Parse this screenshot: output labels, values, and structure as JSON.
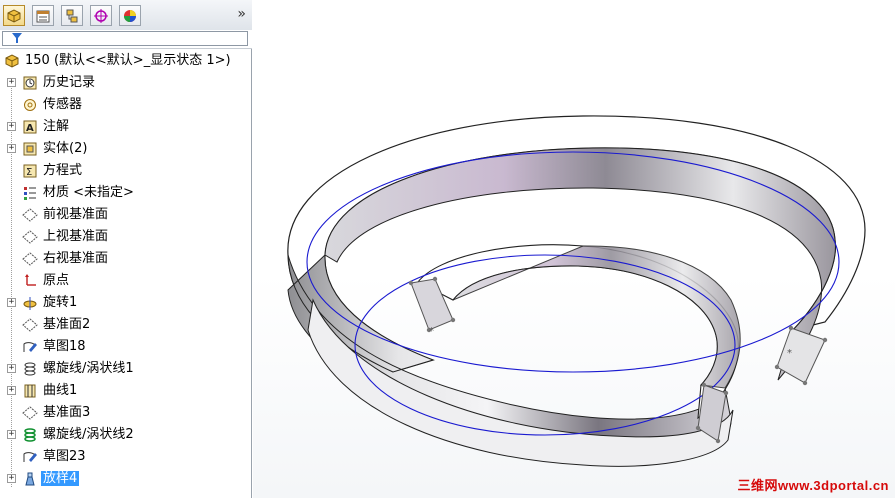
{
  "toolbar": {
    "tabs": [
      {
        "name": "feature-manager-tab",
        "icon": "feature-tree-icon",
        "active": true
      },
      {
        "name": "property-manager-tab",
        "icon": "property-icon",
        "active": false
      },
      {
        "name": "configuration-manager-tab",
        "icon": "configuration-icon",
        "active": false
      },
      {
        "name": "dimxpert-tab",
        "icon": "crosshair-icon",
        "active": false
      },
      {
        "name": "display-manager-tab",
        "icon": "appearance-icon",
        "active": false
      }
    ],
    "more": "»"
  },
  "filter": {
    "icon": "filter-icon",
    "value": ""
  },
  "tree": {
    "root": {
      "label": "150  (默认<<默认>_显示状态 1>)",
      "icon": "part-icon"
    },
    "items": [
      {
        "label": "历史记录",
        "icon": "history-icon",
        "expand": "+"
      },
      {
        "label": "传感器",
        "icon": "sensor-icon",
        "expand": ""
      },
      {
        "label": "注解",
        "icon": "annotation-icon",
        "expand": "+"
      },
      {
        "label": "实体(2)",
        "icon": "solid-bodies-icon",
        "expand": "+"
      },
      {
        "label": "方程式",
        "icon": "equations-icon",
        "expand": ""
      },
      {
        "label": "材质 <未指定>",
        "icon": "material-icon",
        "expand": ""
      },
      {
        "label": "前视基准面",
        "icon": "plane-icon",
        "expand": ""
      },
      {
        "label": "上视基准面",
        "icon": "plane-icon",
        "expand": ""
      },
      {
        "label": "右视基准面",
        "icon": "plane-icon",
        "expand": ""
      },
      {
        "label": "原点",
        "icon": "origin-icon",
        "expand": ""
      },
      {
        "label": "旋转1",
        "icon": "revolve-icon",
        "expand": "+"
      },
      {
        "label": "基准面2",
        "icon": "plane-icon",
        "expand": ""
      },
      {
        "label": "草图18",
        "icon": "sketch-icon",
        "expand": ""
      },
      {
        "label": "螺旋线/涡状线1",
        "icon": "helix-icon",
        "expand": "+"
      },
      {
        "label": "曲线1",
        "icon": "curve-icon",
        "expand": "+"
      },
      {
        "label": "基准面3",
        "icon": "plane-icon",
        "expand": ""
      },
      {
        "label": "螺旋线/涡状线2",
        "icon": "helix-green-icon",
        "expand": "+"
      },
      {
        "label": "草图23",
        "icon": "sketch-icon",
        "expand": ""
      },
      {
        "label": "放样4",
        "icon": "loft-icon",
        "expand": "+",
        "selected": true
      }
    ]
  },
  "viewport": {
    "watermark": "三维网www.3dportal.cn"
  },
  "colors": {
    "selection": "#3399ff",
    "helix": "#1a1ad0",
    "watermark": "#d60a0a"
  }
}
